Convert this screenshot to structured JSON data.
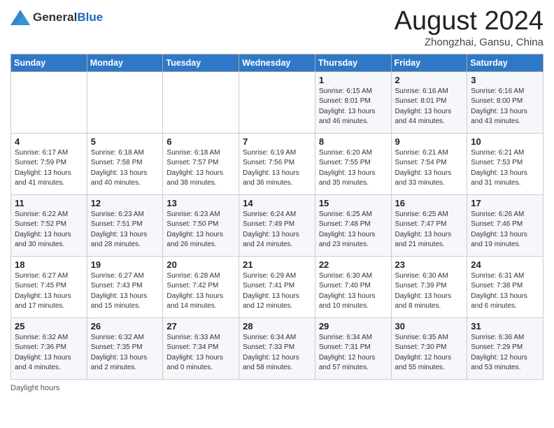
{
  "header": {
    "logo_general": "General",
    "logo_blue": "Blue",
    "month_year": "August 2024",
    "location": "Zhongzhai, Gansu, China"
  },
  "days_of_week": [
    "Sunday",
    "Monday",
    "Tuesday",
    "Wednesday",
    "Thursday",
    "Friday",
    "Saturday"
  ],
  "weeks": [
    [
      {
        "day": "",
        "info": ""
      },
      {
        "day": "",
        "info": ""
      },
      {
        "day": "",
        "info": ""
      },
      {
        "day": "",
        "info": ""
      },
      {
        "day": "1",
        "info": "Sunrise: 6:15 AM\nSunset: 8:01 PM\nDaylight: 13 hours\nand 46 minutes."
      },
      {
        "day": "2",
        "info": "Sunrise: 6:16 AM\nSunset: 8:01 PM\nDaylight: 13 hours\nand 44 minutes."
      },
      {
        "day": "3",
        "info": "Sunrise: 6:16 AM\nSunset: 8:00 PM\nDaylight: 13 hours\nand 43 minutes."
      }
    ],
    [
      {
        "day": "4",
        "info": "Sunrise: 6:17 AM\nSunset: 7:59 PM\nDaylight: 13 hours\nand 41 minutes."
      },
      {
        "day": "5",
        "info": "Sunrise: 6:18 AM\nSunset: 7:58 PM\nDaylight: 13 hours\nand 40 minutes."
      },
      {
        "day": "6",
        "info": "Sunrise: 6:18 AM\nSunset: 7:57 PM\nDaylight: 13 hours\nand 38 minutes."
      },
      {
        "day": "7",
        "info": "Sunrise: 6:19 AM\nSunset: 7:56 PM\nDaylight: 13 hours\nand 36 minutes."
      },
      {
        "day": "8",
        "info": "Sunrise: 6:20 AM\nSunset: 7:55 PM\nDaylight: 13 hours\nand 35 minutes."
      },
      {
        "day": "9",
        "info": "Sunrise: 6:21 AM\nSunset: 7:54 PM\nDaylight: 13 hours\nand 33 minutes."
      },
      {
        "day": "10",
        "info": "Sunrise: 6:21 AM\nSunset: 7:53 PM\nDaylight: 13 hours\nand 31 minutes."
      }
    ],
    [
      {
        "day": "11",
        "info": "Sunrise: 6:22 AM\nSunset: 7:52 PM\nDaylight: 13 hours\nand 30 minutes."
      },
      {
        "day": "12",
        "info": "Sunrise: 6:23 AM\nSunset: 7:51 PM\nDaylight: 13 hours\nand 28 minutes."
      },
      {
        "day": "13",
        "info": "Sunrise: 6:23 AM\nSunset: 7:50 PM\nDaylight: 13 hours\nand 26 minutes."
      },
      {
        "day": "14",
        "info": "Sunrise: 6:24 AM\nSunset: 7:49 PM\nDaylight: 13 hours\nand 24 minutes."
      },
      {
        "day": "15",
        "info": "Sunrise: 6:25 AM\nSunset: 7:48 PM\nDaylight: 13 hours\nand 23 minutes."
      },
      {
        "day": "16",
        "info": "Sunrise: 6:25 AM\nSunset: 7:47 PM\nDaylight: 13 hours\nand 21 minutes."
      },
      {
        "day": "17",
        "info": "Sunrise: 6:26 AM\nSunset: 7:46 PM\nDaylight: 13 hours\nand 19 minutes."
      }
    ],
    [
      {
        "day": "18",
        "info": "Sunrise: 6:27 AM\nSunset: 7:45 PM\nDaylight: 13 hours\nand 17 minutes."
      },
      {
        "day": "19",
        "info": "Sunrise: 6:27 AM\nSunset: 7:43 PM\nDaylight: 13 hours\nand 15 minutes."
      },
      {
        "day": "20",
        "info": "Sunrise: 6:28 AM\nSunset: 7:42 PM\nDaylight: 13 hours\nand 14 minutes."
      },
      {
        "day": "21",
        "info": "Sunrise: 6:29 AM\nSunset: 7:41 PM\nDaylight: 13 hours\nand 12 minutes."
      },
      {
        "day": "22",
        "info": "Sunrise: 6:30 AM\nSunset: 7:40 PM\nDaylight: 13 hours\nand 10 minutes."
      },
      {
        "day": "23",
        "info": "Sunrise: 6:30 AM\nSunset: 7:39 PM\nDaylight: 13 hours\nand 8 minutes."
      },
      {
        "day": "24",
        "info": "Sunrise: 6:31 AM\nSunset: 7:38 PM\nDaylight: 13 hours\nand 6 minutes."
      }
    ],
    [
      {
        "day": "25",
        "info": "Sunrise: 6:32 AM\nSunset: 7:36 PM\nDaylight: 13 hours\nand 4 minutes."
      },
      {
        "day": "26",
        "info": "Sunrise: 6:32 AM\nSunset: 7:35 PM\nDaylight: 13 hours\nand 2 minutes."
      },
      {
        "day": "27",
        "info": "Sunrise: 6:33 AM\nSunset: 7:34 PM\nDaylight: 13 hours\nand 0 minutes."
      },
      {
        "day": "28",
        "info": "Sunrise: 6:34 AM\nSunset: 7:33 PM\nDaylight: 12 hours\nand 58 minutes."
      },
      {
        "day": "29",
        "info": "Sunrise: 6:34 AM\nSunset: 7:31 PM\nDaylight: 12 hours\nand 57 minutes."
      },
      {
        "day": "30",
        "info": "Sunrise: 6:35 AM\nSunset: 7:30 PM\nDaylight: 12 hours\nand 55 minutes."
      },
      {
        "day": "31",
        "info": "Sunrise: 6:36 AM\nSunset: 7:29 PM\nDaylight: 12 hours\nand 53 minutes."
      }
    ]
  ],
  "footer": {
    "daylight_hours_label": "Daylight hours"
  }
}
